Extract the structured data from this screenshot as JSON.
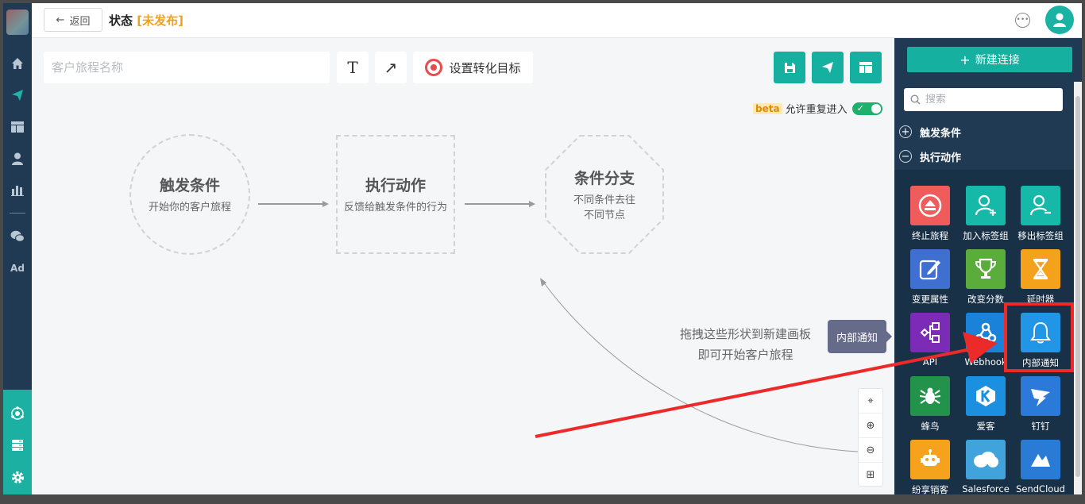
{
  "topbar": {
    "back_label": "返回",
    "title": "状态",
    "status_open": "[",
    "status_text": "未发布",
    "status_close": "]"
  },
  "canvas": {
    "name_placeholder": "客户旅程名称",
    "text_tool": "T",
    "arrow_tool": "↗",
    "goal_label": "设置转化目标",
    "beta_badge": "beta",
    "reentry_label": "允许重复进入",
    "reentry_enabled": true,
    "shapes": [
      {
        "title": "触发条件",
        "subtitle": "开始你的客户旅程"
      },
      {
        "title": "执行动作",
        "subtitle": "反馈给触发条件的行为"
      },
      {
        "title": "条件分支",
        "subtitle_line1": "不同条件去往",
        "subtitle_line2": "不同节点"
      }
    ],
    "hint_line1": "拖拽这些形状到新建画板",
    "hint_line2": "即可开始客户旅程",
    "tooltip": "内部通知"
  },
  "panel": {
    "new_connection": "新建连接",
    "search_placeholder": "搜索",
    "section_trigger": "触发条件",
    "section_action": "执行动作",
    "tiles": [
      {
        "label": "终止旅程",
        "color": "#f05b5b",
        "icon": "eject-icon"
      },
      {
        "label": "加入标签组",
        "color": "#16b8a8",
        "icon": "user-add-icon"
      },
      {
        "label": "移出标签组",
        "color": "#16b8a8",
        "icon": "user-remove-icon"
      },
      {
        "label": "变更属性",
        "color": "#3f6fd1",
        "icon": "edit-icon"
      },
      {
        "label": "改变分数",
        "color": "#5aad3a",
        "icon": "trophy-icon"
      },
      {
        "label": "延时器",
        "color": "#f4a11c",
        "icon": "hourglass-icon"
      },
      {
        "label": "API",
        "color": "#7b2bb5",
        "icon": "api-icon"
      },
      {
        "label": "Webhook",
        "color": "#1a82d8",
        "icon": "webhook-icon"
      },
      {
        "label": "内部通知",
        "color": "#2196e6",
        "icon": "bell-icon"
      },
      {
        "label": "蜂鸟",
        "color": "#23924a",
        "icon": "spider-icon"
      },
      {
        "label": "爱客",
        "color": "#1b8fe0",
        "icon": "k-icon"
      },
      {
        "label": "钉钉",
        "color": "#2b79d8",
        "icon": "dingtalk-icon"
      },
      {
        "label": "纷享销客",
        "color": "#f6a21d",
        "icon": "robot-icon"
      },
      {
        "label": "Salesforce",
        "color": "#41a3db",
        "icon": "cloud-icon"
      },
      {
        "label": "SendCloud",
        "color": "#2a7bd6",
        "icon": "sendcloud-icon"
      }
    ]
  },
  "nav": [
    "home-icon",
    "send-icon",
    "layout-icon",
    "user-icon",
    "chart-icon",
    "wechat-icon",
    "ad-icon",
    "network-icon",
    "server-icon",
    "settings-icon"
  ],
  "nav_ad_text": "Ad"
}
